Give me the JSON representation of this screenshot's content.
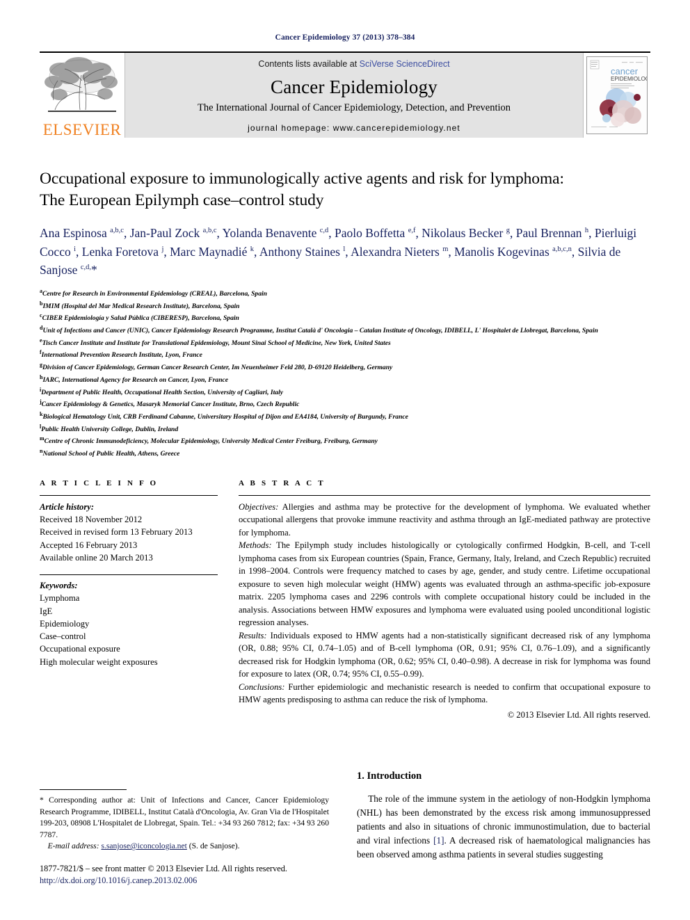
{
  "running_head": "Cancer Epidemiology 37 (2013) 378–384",
  "banner": {
    "publisher_name": "ELSEVIER",
    "contents_prefix": "Contents lists available at ",
    "contents_link": "SciVerse ScienceDirect",
    "journal_title": "Cancer Epidemiology",
    "journal_subtitle": "The International Journal of Cancer Epidemiology, Detection, and Prevention",
    "homepage_label": "journal homepage: www.cancerepidemiology.net",
    "cover_title_1": "cancer",
    "cover_title_2": "EPIDEMIOLOGY",
    "cover_sub": "The International Journal of Cancer Epidemiology, Detection and Prevention",
    "link_color": "#3b4da0",
    "elsevier_color": "#f08020"
  },
  "article": {
    "title_line1": "Occupational exposure to immunologically active agents and risk for lymphoma:",
    "title_line2": "The European Epilymph case–control study",
    "authors_html": "Ana Espinosa <sup>a,b,c</sup>, Jan-Paul Zock <sup>a,b,c</sup>, Yolanda Benavente <sup>c,d</sup>, Paolo Boffetta <sup>e,f</sup>, Nikolaus Becker <sup>g</sup>, Paul Brennan <sup>h</sup>, Pierluigi Cocco <sup>i</sup>, Lenka Foretova <sup>j</sup>, Marc Maynadié <sup>k</sup>, Anthony Staines <sup>l</sup>, Alexandra Nieters <sup>m</sup>, Manolis Kogevinas <sup>a,b,c,n</sup>, Silvia de Sanjose <sup>c,d,</sup>*",
    "author_color": "#16205e",
    "affiliations": [
      {
        "mark": "a",
        "text": "Centre for Research in Environmental Epidemiology (CREAL), Barcelona, Spain"
      },
      {
        "mark": "b",
        "text": "IMIM (Hospital del Mar Medical Research Institute), Barcelona, Spain"
      },
      {
        "mark": "c",
        "text": "CIBER Epidemiología y Salud Pública (CIBERESP), Barcelona, Spain"
      },
      {
        "mark": "d",
        "text": "Unit of Infections and Cancer (UNIC), Cancer Epidemiology Research Programme, Institut Català d' Oncologia – Catalan Institute of Oncology, IDIBELL, L' Hospitalet de Llobregat, Barcelona, Spain"
      },
      {
        "mark": "e",
        "text": "Tisch Cancer Institute and Institute for Translational Epidemiology, Mount Sinai School of Medicine, New York, United States"
      },
      {
        "mark": "f",
        "text": "International Prevention Research Institute, Lyon, France"
      },
      {
        "mark": "g",
        "text": "Division of Cancer Epidemiology, German Cancer Research Center, Im Neuenheimer Feld 280, D-69120 Heidelberg, Germany"
      },
      {
        "mark": "h",
        "text": "IARC, International Agency for Research on Cancer, Lyon, France"
      },
      {
        "mark": "i",
        "text": "Department of Public Health, Occupational Health Section, University of Cagliari, Italy"
      },
      {
        "mark": "j",
        "text": "Cancer Epidemiology & Genetics, Masaryk Memorial Cancer Institute, Brno, Czech Republic"
      },
      {
        "mark": "k",
        "text": "Biological Hematology Unit, CRB Ferdinand Cabanne, Universitary Hospital of Dijon and EA4184, University of Burgundy, France"
      },
      {
        "mark": "l",
        "text": "Public Health University College, Dublin, Ireland"
      },
      {
        "mark": "m",
        "text": "Centre of Chronic Immunodeficiency, Molecular Epidemiology, University Medical Center Freiburg, Freiburg, Germany"
      },
      {
        "mark": "n",
        "text": "National School of Public Health, Athens, Greece"
      }
    ]
  },
  "article_info": {
    "heading": "A R T I C L E  I N F O",
    "history_label": "Article history:",
    "history": [
      "Received 18 November 2012",
      "Received in revised form 13 February 2013",
      "Accepted 16 February 2013",
      "Available online 20 March 2013"
    ],
    "keywords_label": "Keywords:",
    "keywords": [
      "Lymphoma",
      "IgE",
      "Epidemiology",
      "Case–control",
      "Occupational exposure",
      "High molecular weight exposures"
    ]
  },
  "abstract": {
    "heading": "A B S T R A C T",
    "objectives_label": "Objectives:",
    "objectives_text": " Allergies and asthma may be protective for the development of lymphoma. We evaluated whether occupational allergens that provoke immune reactivity and asthma through an IgE-mediated pathway are protective for lymphoma.",
    "methods_label": "Methods:",
    "methods_text": " The Epilymph study includes histologically or cytologically confirmed Hodgkin, B-cell, and T-cell lymphoma cases from six European countries (Spain, France, Germany, Italy, Ireland, and Czech Republic) recruited in 1998–2004. Controls were frequency matched to cases by age, gender, and study centre. Lifetime occupational exposure to seven high molecular weight (HMW) agents was evaluated through an asthma-specific job-exposure matrix. 2205 lymphoma cases and 2296 controls with complete occupational history could be included in the analysis. Associations between HMW exposures and lymphoma were evaluated using pooled unconditional logistic regression analyses.",
    "results_label": "Results:",
    "results_text": " Individuals exposed to HMW agents had a non-statistically significant decreased risk of any lymphoma (OR, 0.88; 95% CI, 0.74–1.05) and of B-cell lymphoma (OR, 0.91; 95% CI, 0.76–1.09), and a significantly decreased risk for Hodgkin lymphoma (OR, 0.62; 95% CI, 0.40–0.98). A decrease in risk for lymphoma was found for exposure to latex (OR, 0.74; 95% CI, 0.55–0.99).",
    "conclusions_label": "Conclusions:",
    "conclusions_text": " Further epidemiologic and mechanistic research is needed to confirm that occupational exposure to HMW agents predisposing to asthma can reduce the risk of lymphoma.",
    "copyright": "© 2013 Elsevier Ltd. All rights reserved."
  },
  "introduction": {
    "section_number_title": "1. Introduction",
    "paragraph_part1": "The role of the immune system in the aetiology of non-Hodgkin lymphoma (NHL) has been demonstrated by the excess risk among immunosuppressed patients and also in situations of chronic immunostimulation, due to bacterial and viral infections ",
    "citation": "[1]",
    "paragraph_part2": ". A decreased risk of haematological malignancies has been observed among asthma patients in several studies suggesting"
  },
  "footnote": {
    "marker": "*",
    "text": " Corresponding author at: Unit of Infections and Cancer, Cancer Epidemiology Research Programme, IDIBELL, Institut Català d'Oncologia, Av. Gran Via de l'Hospitalet 199-203, 08908 L'Hospitalet de Llobregat, Spain. Tel.: +34 93 260 7812; fax: +34 93 260 7787.",
    "email_label": "E-mail address:",
    "email": "s.sanjose@iconcologia.net",
    "email_suffix": " (S. de Sanjose)."
  },
  "page_footer": {
    "issn_line": "1877-7821/$ – see front matter © 2013 Elsevier Ltd. All rights reserved.",
    "doi": "http://dx.doi.org/10.1016/j.canep.2013.02.006"
  }
}
